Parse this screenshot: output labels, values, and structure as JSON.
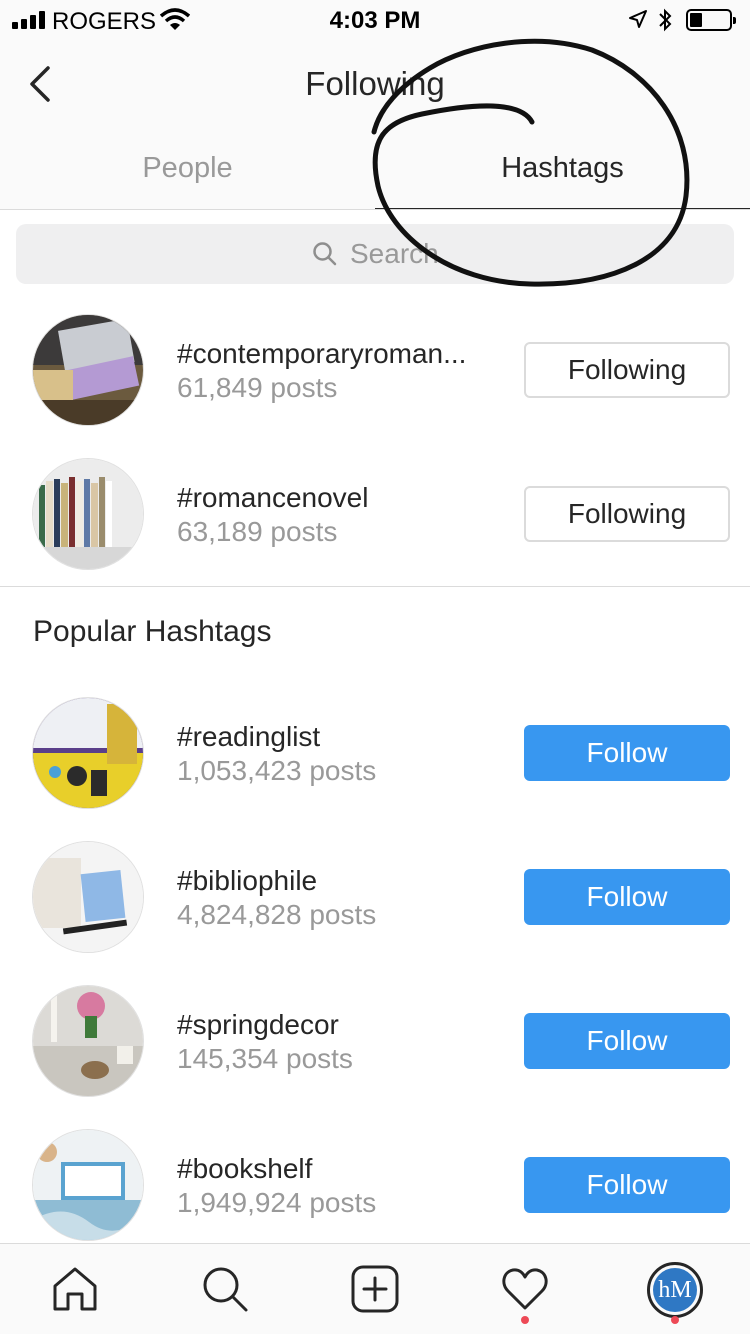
{
  "status_bar": {
    "carrier": "ROGERS",
    "time": "4:03 PM",
    "icons": [
      "signal-icon",
      "wifi-icon",
      "location-icon",
      "bluetooth-icon",
      "battery-icon"
    ]
  },
  "header": {
    "title": "Following",
    "back_icon": "chevron-left-icon",
    "tabs": [
      {
        "label": "People",
        "active": false
      },
      {
        "label": "Hashtags",
        "active": true
      }
    ]
  },
  "search": {
    "placeholder": "Search",
    "icon": "search-icon"
  },
  "following_hashtags": [
    {
      "tag": "#contemporaryroman...",
      "posts": "61,849 posts",
      "button": "Following"
    },
    {
      "tag": "#romancenovel",
      "posts": "63,189 posts",
      "button": "Following"
    }
  ],
  "popular": {
    "title": "Popular Hashtags",
    "items": [
      {
        "tag": "#readinglist",
        "posts": "1,053,423 posts",
        "button": "Follow"
      },
      {
        "tag": "#bibliophile",
        "posts": "4,824,828 posts",
        "button": "Follow"
      },
      {
        "tag": "#springdecor",
        "posts": "145,354 posts",
        "button": "Follow"
      },
      {
        "tag": "#bookshelf",
        "posts": "1,949,924 posts",
        "button": "Follow"
      }
    ]
  },
  "tab_bar": {
    "items": [
      "home-icon",
      "search-icon",
      "add-post-icon",
      "activity-heart-icon",
      "profile-avatar"
    ],
    "profile_initials": "hM"
  },
  "colors": {
    "follow_blue": "#3897f0",
    "notification_red": "#ed4956",
    "muted_text": "#999999"
  }
}
